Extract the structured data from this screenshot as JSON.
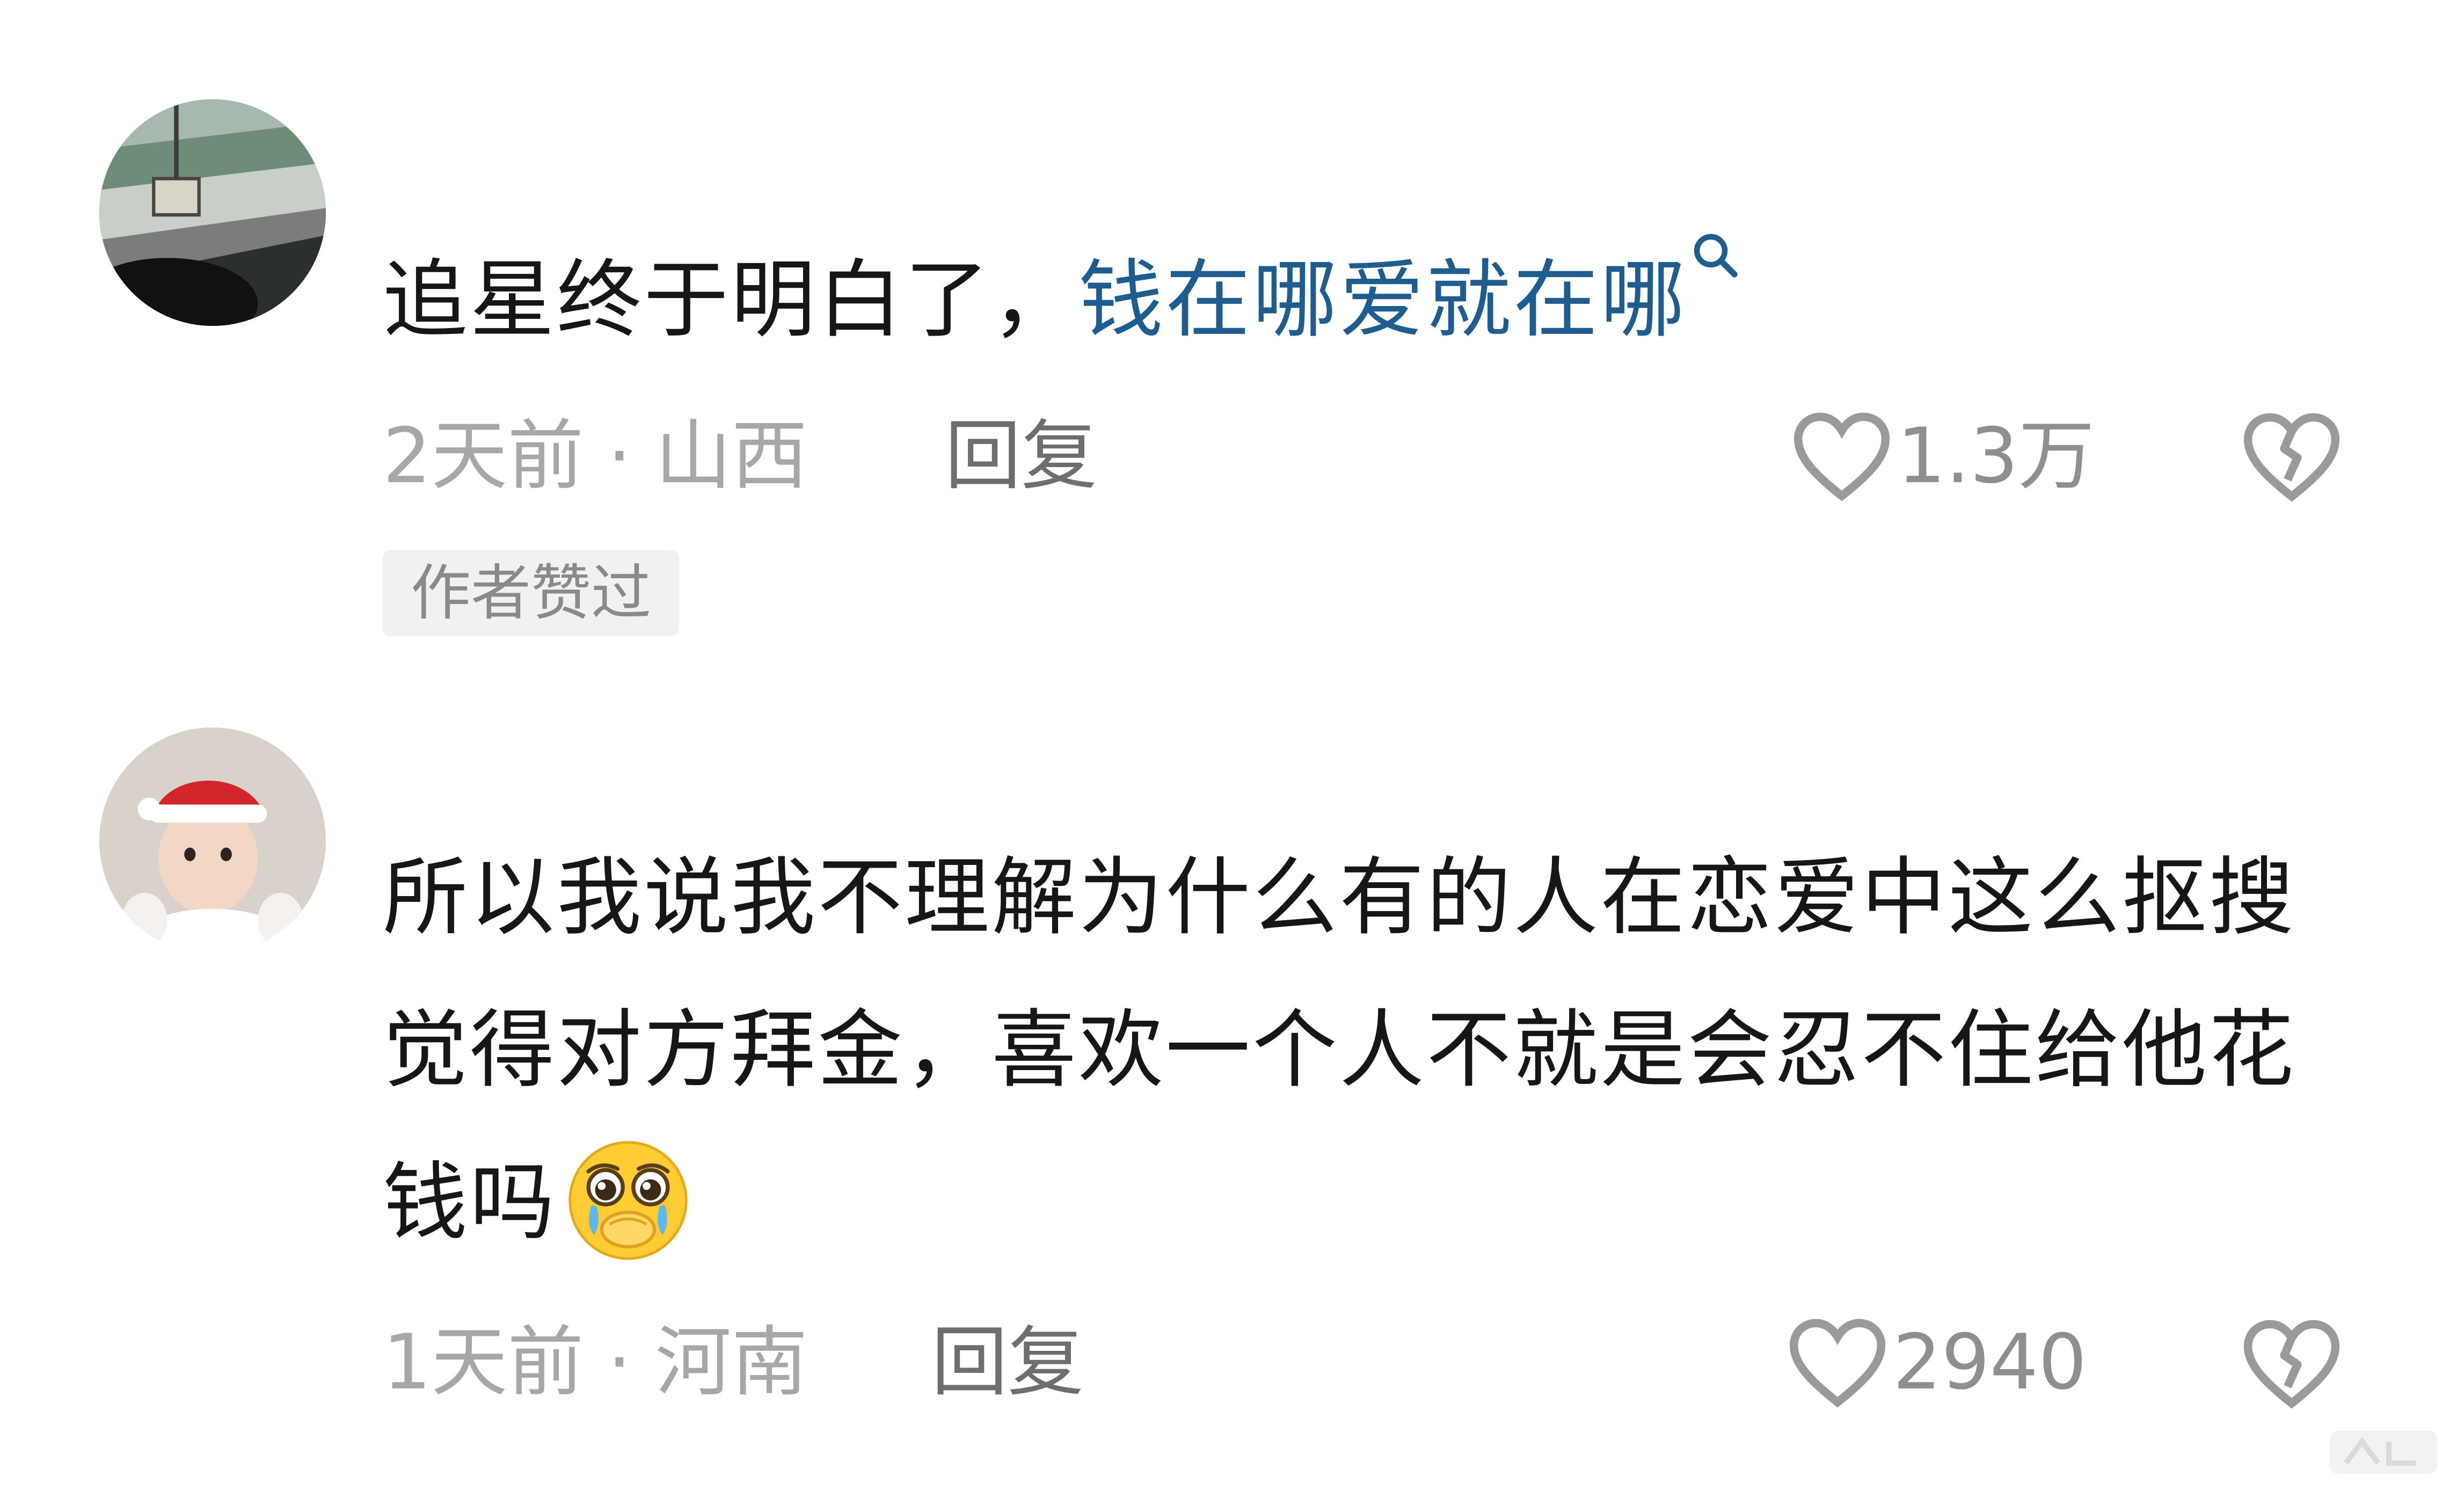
{
  "comments": [
    {
      "text_plain": "追星终于明白了，",
      "text_keyword": "钱在哪爱就在哪",
      "keyword_icon": "search-icon",
      "time": "2天前",
      "separator": "·",
      "location": "山西",
      "reply_label": "回复",
      "like_icon": "heart-outline-icon",
      "likes": "1.3万",
      "dislike_icon": "broken-heart-icon",
      "badge": "作者赞过",
      "avatar": "avatar-photo-car-mirror"
    },
    {
      "text": "所以我说我不理解为什么有的人在恋爱中这么抠搜 觉得对方拜金，喜欢一个人不就是会忍不住给他花钱吗",
      "emoji": "pleading-face-emoji",
      "time": "1天前",
      "separator": "·",
      "location": "河南",
      "reply_label": "回复",
      "like_icon": "heart-outline-icon",
      "likes": "2940",
      "dislike_icon": "broken-heart-icon",
      "avatar": "avatar-photo-child-santa-hat"
    }
  ],
  "colors": {
    "keyword": "#1f5c8f",
    "text": "#161616",
    "meta": "#a7a7a7",
    "reply": "#6e6e6e",
    "badge_bg": "#f1f1f1"
  }
}
